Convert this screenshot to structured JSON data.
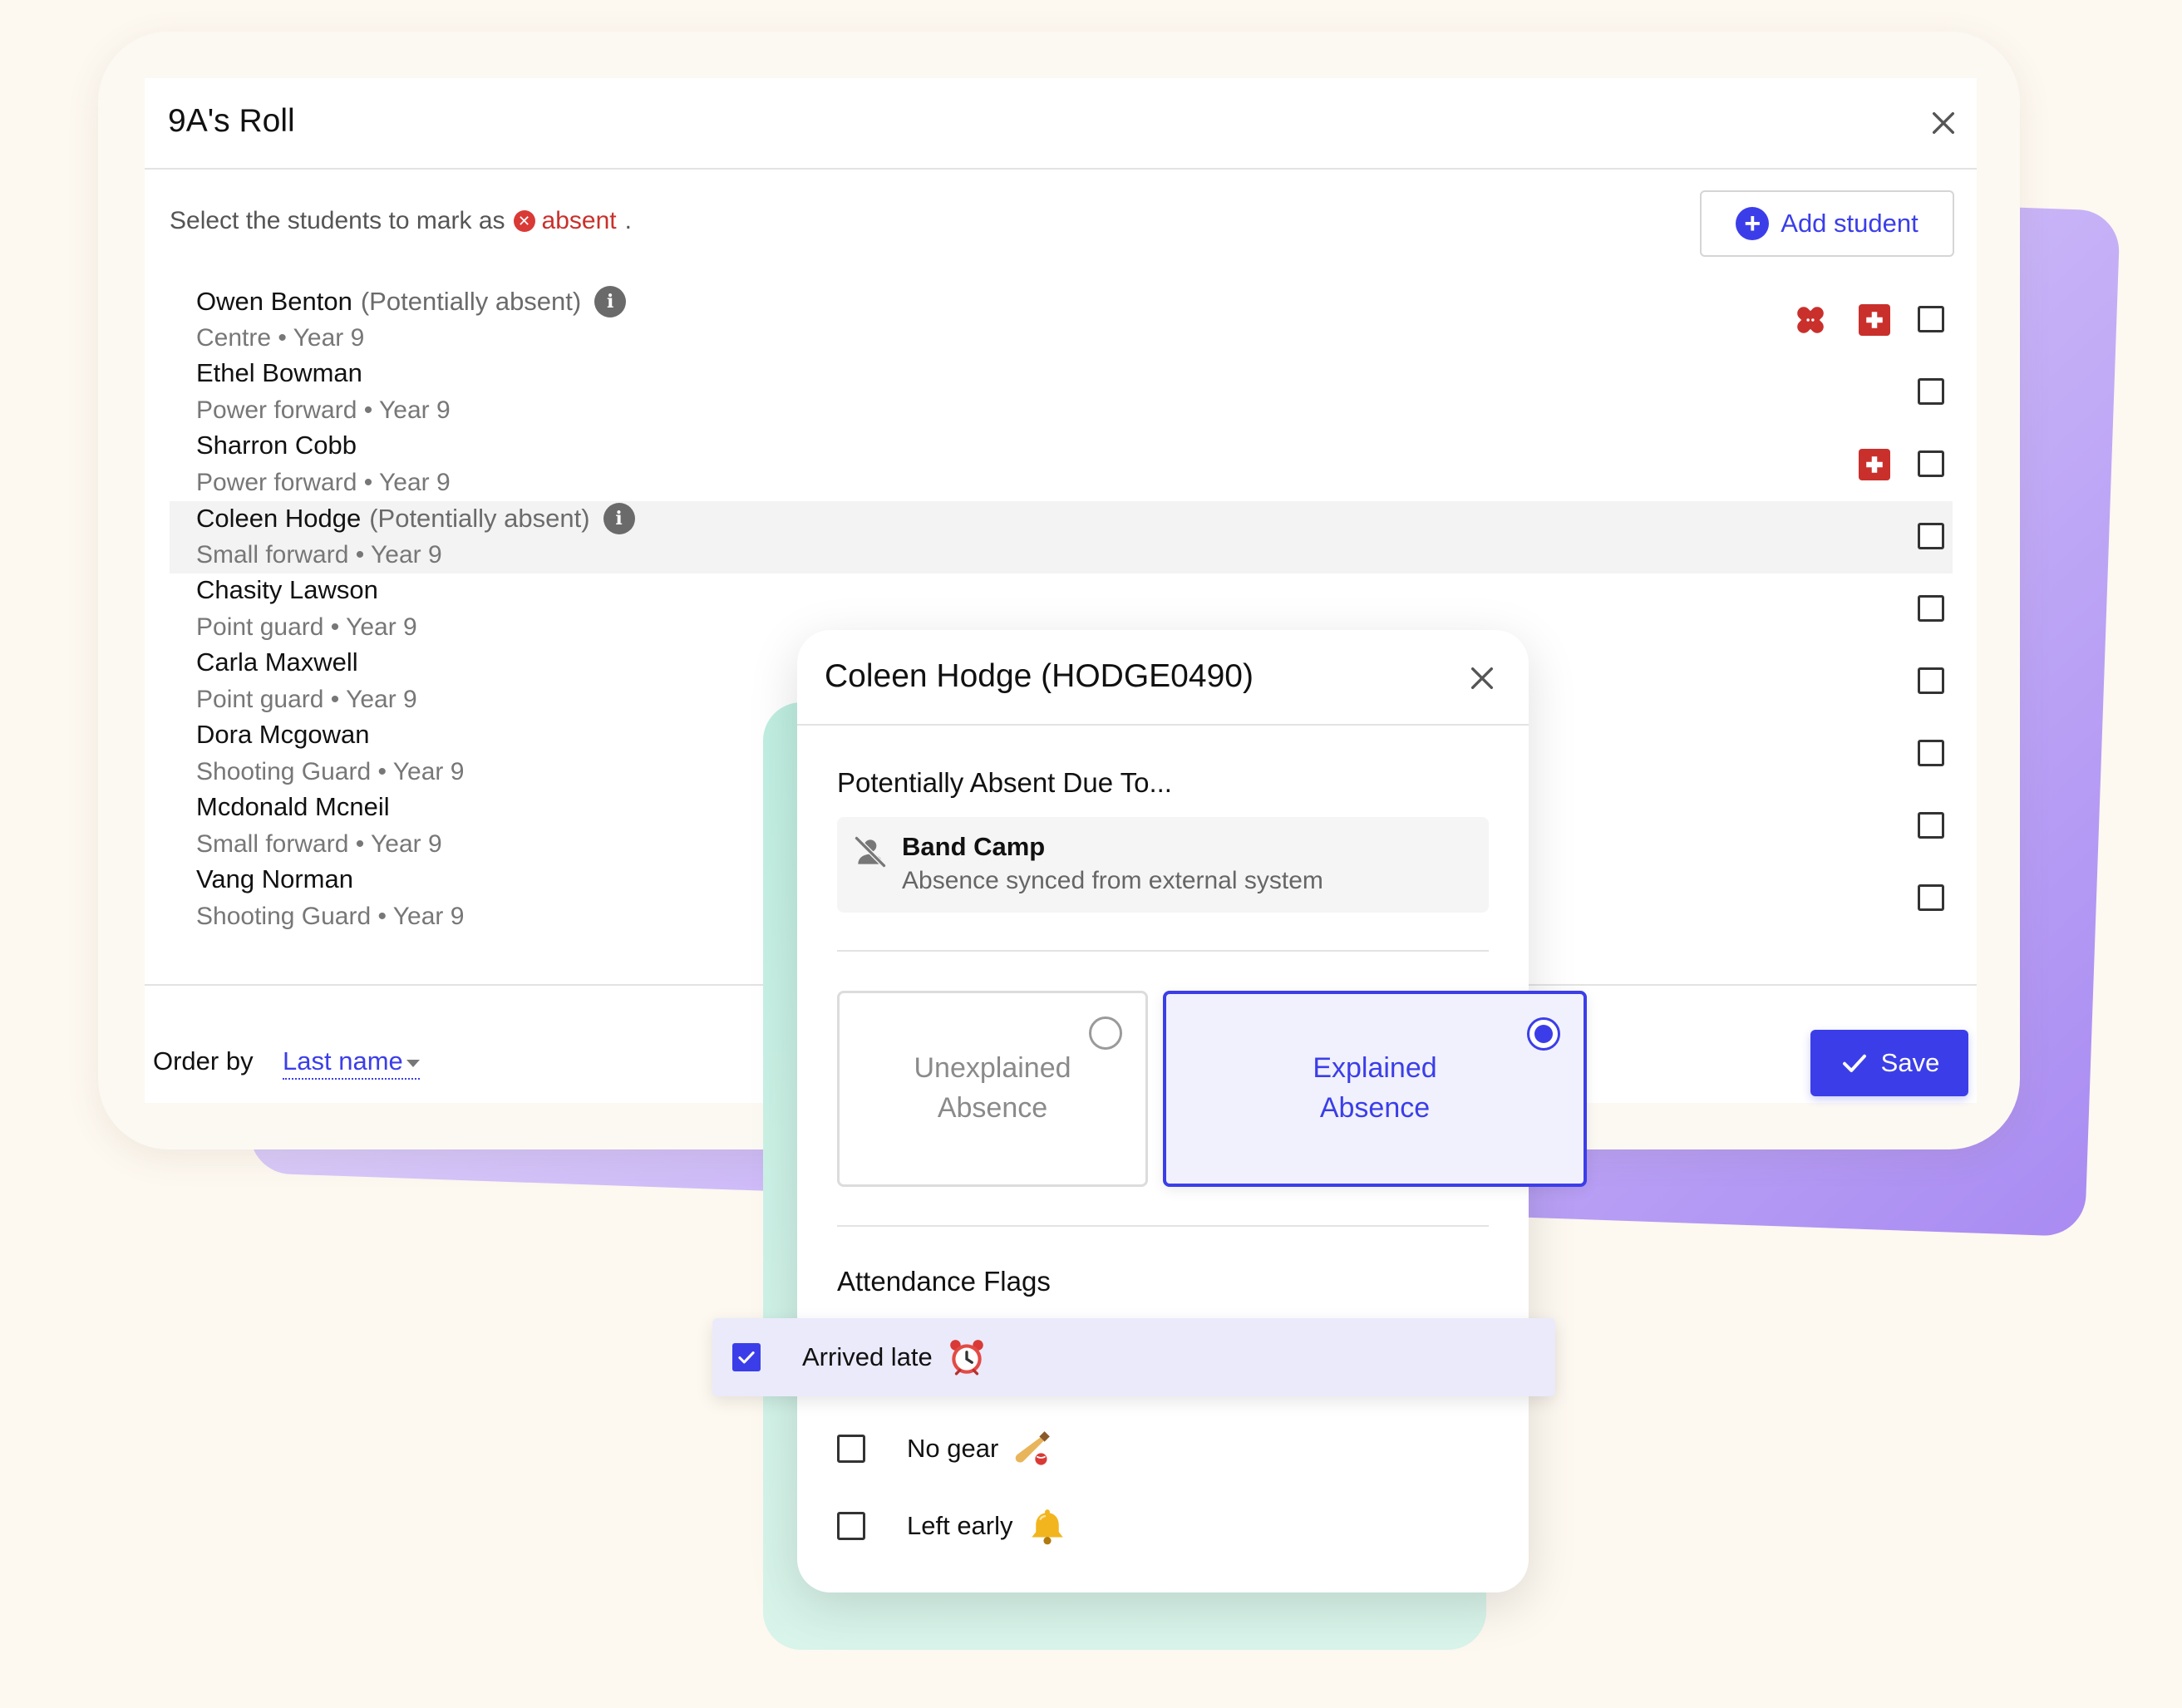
{
  "roll": {
    "title": "9A's Roll",
    "instruction_prefix": "Select the students to mark as",
    "absent_label": "absent",
    "instruction_suffix": ".",
    "add_student_label": "Add student",
    "order_by_label": "Order by",
    "order_by_value": "Last name",
    "save_label": "Save",
    "students": [
      {
        "name": "Owen Benton",
        "flag": "(Potentially absent)",
        "sub": "Centre • Year 9",
        "info": true,
        "icons": [
          "bandage-icon",
          "medical-icon"
        ]
      },
      {
        "name": "Ethel Bowman",
        "flag": "",
        "sub": "Power forward • Year 9",
        "info": false,
        "icons": []
      },
      {
        "name": "Sharron Cobb",
        "flag": "",
        "sub": "Power forward • Year 9",
        "info": false,
        "icons": [
          "medical-icon"
        ]
      },
      {
        "name": "Coleen Hodge",
        "flag": "(Potentially absent)",
        "sub": "Small forward • Year 9",
        "info": true,
        "icons": [],
        "highlighted": true
      },
      {
        "name": "Chasity Lawson",
        "flag": "",
        "sub": "Point guard • Year 9",
        "info": false,
        "icons": []
      },
      {
        "name": "Carla Maxwell",
        "flag": "",
        "sub": "Point guard • Year 9",
        "info": false,
        "icons": []
      },
      {
        "name": "Dora Mcgowan",
        "flag": "",
        "sub": "Shooting Guard • Year 9",
        "info": false,
        "icons": []
      },
      {
        "name": "Mcdonald Mcneil",
        "flag": "",
        "sub": "Small forward • Year 9",
        "info": false,
        "icons": []
      },
      {
        "name": "Vang Norman",
        "flag": "",
        "sub": "Shooting Guard • Year 9",
        "info": false,
        "icons": []
      }
    ]
  },
  "popup": {
    "title": "Coleen Hodge (HODGE0490)",
    "reason_heading": "Potentially Absent Due To...",
    "reason_title": "Band Camp",
    "reason_sub": "Absence synced from external system",
    "options": {
      "unexplained": "Unexplained Absence",
      "explained": "Explained Absence",
      "selected": "explained"
    },
    "flags_heading": "Attendance Flags",
    "flags": [
      {
        "label": "Arrived late",
        "checked": true,
        "icon": "alarm-clock-icon"
      },
      {
        "label": "No gear",
        "checked": false,
        "icon": "cricket-bat-icon"
      },
      {
        "label": "Left early",
        "checked": false,
        "icon": "bell-icon"
      }
    ]
  },
  "colors": {
    "accent": "#3b3ee8",
    "absent": "#c9302c",
    "background": "#fdf8f0"
  }
}
